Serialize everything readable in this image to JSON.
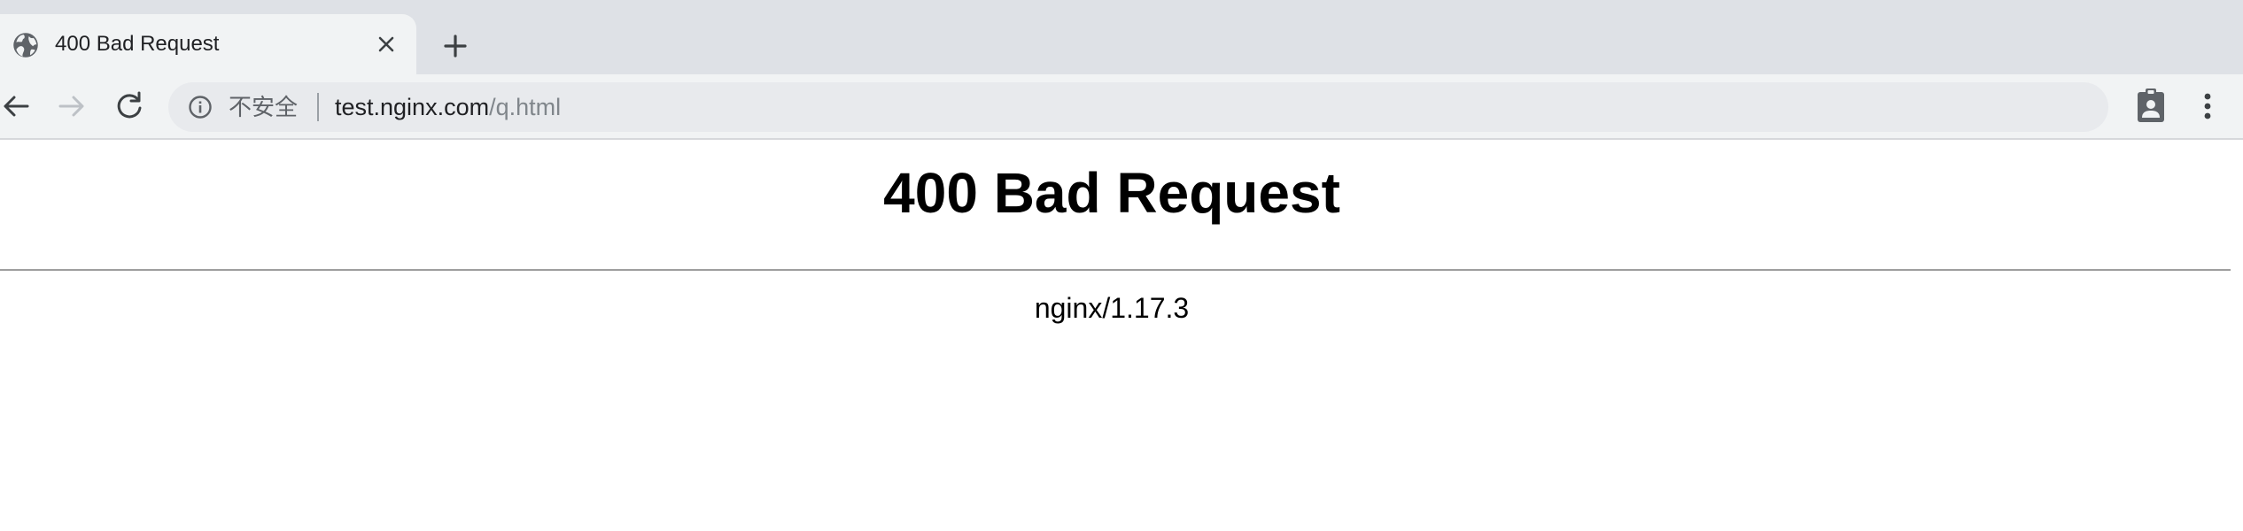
{
  "tab": {
    "title": "400 Bad Request",
    "favicon_icon": "globe-icon",
    "close_icon": "close-icon"
  },
  "toolbar": {
    "new_tab_icon": "plus-icon",
    "back_icon": "arrow-left-icon",
    "forward_icon": "arrow-right-icon",
    "reload_icon": "reload-icon",
    "info_icon": "info-icon",
    "security_label": "不安全",
    "url_host": "test.nginx.com",
    "url_path": "/q.html",
    "extension_icon": "clipboard-account-icon",
    "menu_icon": "more-vertical-icon"
  },
  "page": {
    "heading": "400 Bad Request",
    "server_signature": "nginx/1.17.3"
  },
  "colors": {
    "tabstrip_bg": "#dee1e6",
    "toolbar_bg": "#f1f3f4",
    "omnibox_bg": "#e8eaed",
    "url_path_color": "#80868b",
    "forward_disabled": "#bdc1c6"
  }
}
